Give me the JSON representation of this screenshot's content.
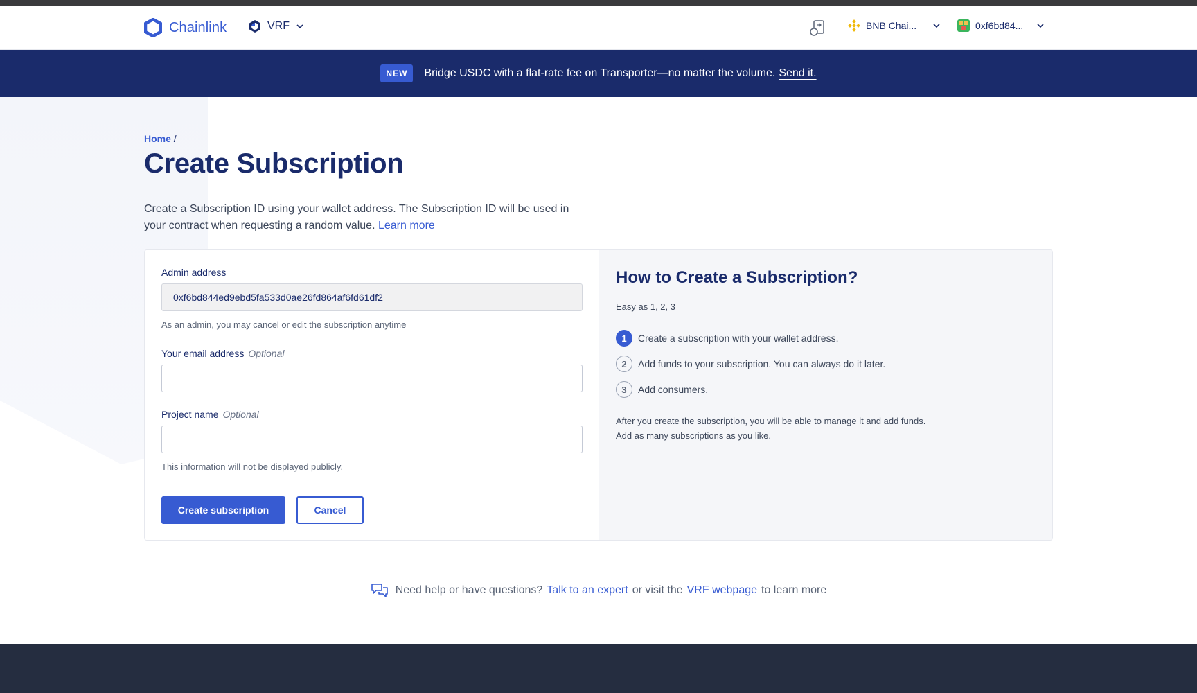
{
  "header": {
    "brand": "Chainlink",
    "product": "VRF",
    "network": "BNB Chai...",
    "account": "0xf6bd84..."
  },
  "banner": {
    "badge": "NEW",
    "text": "Bridge USDC with a flat-rate fee on Transporter—no matter the volume.",
    "link": "Send it."
  },
  "breadcrumb": {
    "home": "Home",
    "separator": "/"
  },
  "page": {
    "title": "Create Subscription",
    "intro": "Create a Subscription ID using your wallet address. The Subscription ID will be used in your contract when requesting a random value.",
    "learn_more": "Learn more"
  },
  "form": {
    "admin_label": "Admin address",
    "admin_value": "0xf6bd844ed9ebd5fa533d0ae26fd864af6fd61df2",
    "admin_hint": "As an admin, you may cancel or edit the subscription anytime",
    "email_label": "Your email address",
    "email_optional": "Optional",
    "email_value": "",
    "project_label": "Project name",
    "project_optional": "Optional",
    "project_value": "",
    "project_hint": "This information will not be displayed publicly.",
    "submit": "Create subscription",
    "cancel": "Cancel"
  },
  "howto": {
    "title": "How to Create a Subscription?",
    "subtitle": "Easy as 1, 2, 3",
    "steps": [
      {
        "num": "1",
        "text": "Create a subscription with your wallet address."
      },
      {
        "num": "2",
        "text": "Add funds to your subscription. You can always do it later."
      },
      {
        "num": "3",
        "text": "Add consumers."
      }
    ],
    "note_line1": "After you create the subscription, you will be able to manage it and add funds.",
    "note_line2": "Add as many subscriptions as you like."
  },
  "help": {
    "prefix": "Need help or have questions?",
    "expert_link": "Talk to an expert",
    "middle": "or visit the",
    "webpage_link": "VRF webpage",
    "suffix": "to learn more"
  },
  "colors": {
    "accent": "#375bd2",
    "navy": "#1a2b6b",
    "footer": "#252d40"
  }
}
